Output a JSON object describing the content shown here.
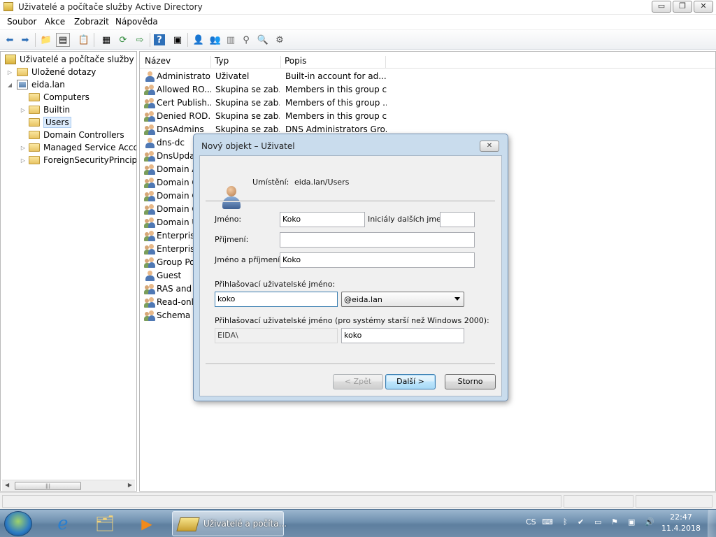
{
  "window": {
    "title": "Uživatelé a počítače služby Active Directory",
    "buttons": {
      "minimize": "▭",
      "maximize": "❐",
      "close": "✕"
    }
  },
  "menu": {
    "items": [
      "Soubor",
      "Akce",
      "Zobrazit",
      "Nápověda"
    ]
  },
  "toolbar": {
    "icons": [
      "back-arrow-icon",
      "forward-arrow-icon",
      "up-folder-icon",
      "show-tree-icon",
      "properties-icon",
      "export-list-icon",
      "refresh-icon",
      "export-icon",
      "help-icon",
      "view-icon",
      "new-user-icon",
      "new-group-icon",
      "new-ou-icon",
      "filter-icon",
      "find-icon",
      "move-icon"
    ]
  },
  "tree": {
    "root": "Uživatelé a počítače služby Active Directory",
    "saved_queries": "Uložené dotazy",
    "domain": "eida.lan",
    "children": [
      "Computers",
      "Builtin",
      "Users",
      "Domain Controllers",
      "Managed Service Accounts",
      "ForeignSecurityPrincipals"
    ],
    "selected": "Users"
  },
  "list": {
    "columns": [
      "Název",
      "Typ",
      "Popis"
    ],
    "rows": [
      {
        "name": "Administrator",
        "type": "Uživatel",
        "desc": "Built-in account for ad...",
        "kind": "user"
      },
      {
        "name": "Allowed RO...",
        "type": "Skupina se zab...",
        "desc": "Members in this group c...",
        "kind": "group"
      },
      {
        "name": "Cert Publish...",
        "type": "Skupina se zab...",
        "desc": "Members of this group ...",
        "kind": "group"
      },
      {
        "name": "Denied ROD...",
        "type": "Skupina se zab...",
        "desc": "Members in this group c...",
        "kind": "group"
      },
      {
        "name": "DnsAdmins",
        "type": "Skupina se zab...",
        "desc": "DNS Administrators Gro...",
        "kind": "group"
      },
      {
        "name": "dns-dc",
        "type": "",
        "desc": "",
        "kind": "user"
      },
      {
        "name": "DnsUpdat",
        "type": "",
        "desc": "",
        "kind": "group"
      },
      {
        "name": "Domain A",
        "type": "",
        "desc": "",
        "kind": "group"
      },
      {
        "name": "Domain C",
        "type": "",
        "desc": "",
        "kind": "group"
      },
      {
        "name": "Domain C",
        "type": "",
        "desc": "",
        "kind": "group"
      },
      {
        "name": "Domain G",
        "type": "",
        "desc": "",
        "kind": "group"
      },
      {
        "name": "Domain U",
        "type": "",
        "desc": "",
        "kind": "group"
      },
      {
        "name": "Enterprise",
        "type": "",
        "desc": "",
        "kind": "group"
      },
      {
        "name": "Enterprise",
        "type": "",
        "desc": "",
        "kind": "group"
      },
      {
        "name": "Group Pol",
        "type": "",
        "desc": "",
        "kind": "group"
      },
      {
        "name": "Guest",
        "type": "",
        "desc": "",
        "kind": "user"
      },
      {
        "name": "RAS and IA",
        "type": "",
        "desc": "",
        "kind": "group"
      },
      {
        "name": "Read-only",
        "type": "",
        "desc": "",
        "kind": "group"
      },
      {
        "name": "Schema A",
        "type": "",
        "desc": "",
        "kind": "group"
      }
    ]
  },
  "dialog": {
    "title": "Nový objekt – Uživatel",
    "location_label": "Umístění:",
    "location_value": "eida.lan/Users",
    "first_name_label": "Jméno:",
    "first_name_value": "Koko",
    "initials_label": "Iniciály dalších jmen:",
    "initials_value": "",
    "last_name_label": "Příjmení:",
    "last_name_value": "",
    "full_name_label": "Jméno a příjmení:",
    "full_name_value": "Koko",
    "logon_label": "Přihlašovací uživatelské jméno:",
    "logon_value": "koko",
    "domain_suffix": "@eida.lan",
    "legacy_label": "Přihlašovací uživatelské jméno (pro systémy starší než Windows 2000):",
    "legacy_domain": "EIDA\\",
    "legacy_value": "koko",
    "back_button": "< Zpět",
    "next_button": "Další >",
    "cancel_button": "Storno"
  },
  "taskbar": {
    "active_app": "Uživatelé a počíta...",
    "language": "CS",
    "time": "22:47",
    "date": "11.4.2018"
  }
}
